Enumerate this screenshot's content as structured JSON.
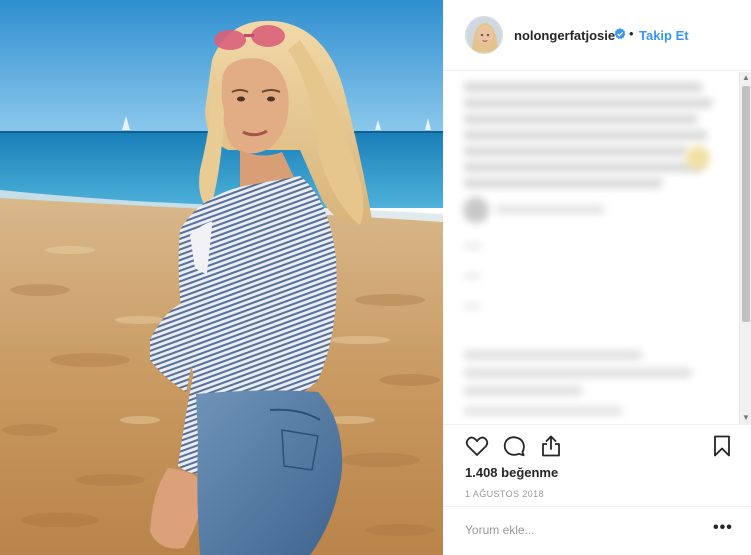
{
  "post": {
    "username": "nolongerfatjosie",
    "separator": "•",
    "follow_label": "Takip Et",
    "likes": "1.408 beğenme",
    "date": "1 AĞUSTOS 2018"
  },
  "comment_box": {
    "placeholder": "Yorum ekle...",
    "more_label": "•••"
  },
  "colors": {
    "accent": "#3897f0",
    "verified": "#3897f0",
    "text": "#262626",
    "muted": "#999999"
  },
  "icons": [
    "heart-icon",
    "comment-icon",
    "share-icon",
    "bookmark-icon",
    "verified-badge-icon"
  ]
}
